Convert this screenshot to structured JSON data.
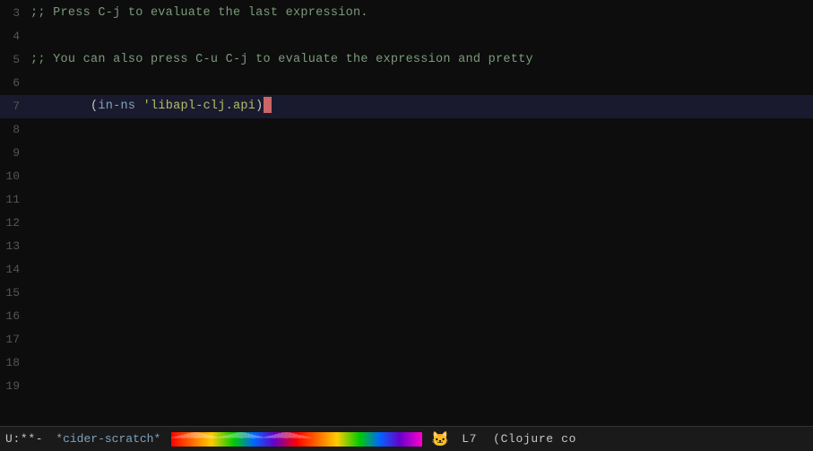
{
  "editor": {
    "background": "#0d0d0d",
    "lines": [
      {
        "number": 3,
        "content": ";; Press C-j to evaluate the last expression.",
        "type": "comment"
      },
      {
        "number": 4,
        "content": "",
        "type": "empty"
      },
      {
        "number": 5,
        "content": ";; You can also press C-u C-j to evaluate the expression and pretty",
        "type": "comment"
      },
      {
        "number": 6,
        "content": "",
        "type": "empty"
      },
      {
        "number": 7,
        "content": "(in-ns 'libapl-clj.api)",
        "type": "code",
        "highlighted": true
      },
      {
        "number": 8,
        "content": "",
        "type": "empty"
      },
      {
        "number": 9,
        "content": "",
        "type": "empty"
      },
      {
        "number": 10,
        "content": "",
        "type": "empty"
      },
      {
        "number": 11,
        "content": "",
        "type": "empty"
      },
      {
        "number": 12,
        "content": "",
        "type": "empty"
      },
      {
        "number": 13,
        "content": "",
        "type": "empty"
      },
      {
        "number": 14,
        "content": "",
        "type": "empty"
      },
      {
        "number": 15,
        "content": "",
        "type": "empty"
      },
      {
        "number": 16,
        "content": "",
        "type": "empty"
      },
      {
        "number": 17,
        "content": "",
        "type": "empty"
      },
      {
        "number": 18,
        "content": "",
        "type": "empty"
      },
      {
        "number": 19,
        "content": "",
        "type": "empty"
      }
    ]
  },
  "statusBar": {
    "mode": "U:**-",
    "buffer": "*cider-scratch*",
    "position": "L7",
    "majorMode": "(Clojure co"
  }
}
